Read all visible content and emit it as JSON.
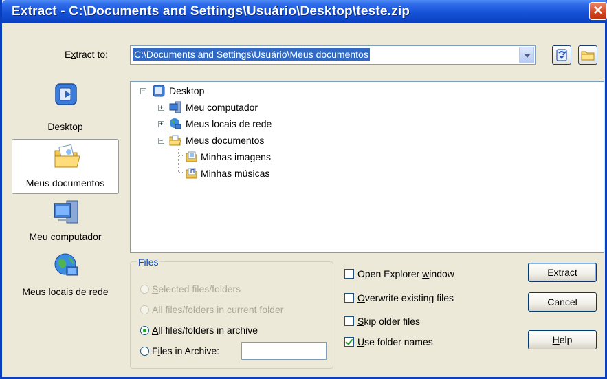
{
  "window": {
    "title": "Extract - C:\\Documents and Settings\\Usuário\\Desktop\\teste.zip",
    "close_glyph": "✕"
  },
  "extract_to": {
    "label_prefix": "E",
    "label_underlined": "x",
    "label_suffix": "tract to:",
    "path": "C:\\Documents and Settings\\Usuário\\Meus documentos"
  },
  "places": [
    {
      "label": "Desktop",
      "icon": "desktop-icon",
      "selected": false
    },
    {
      "label": "Meus documentos",
      "icon": "my-documents-icon",
      "selected": true
    },
    {
      "label": "Meu computador",
      "icon": "my-computer-icon",
      "selected": false
    },
    {
      "label": "Meus locais de rede",
      "icon": "network-places-icon",
      "selected": false
    }
  ],
  "tree": {
    "root": "Desktop",
    "items": [
      {
        "label": "Meu computador",
        "expander": "+"
      },
      {
        "label": "Meus locais de rede",
        "expander": "+"
      },
      {
        "label": "Meus documentos",
        "expander": "−"
      }
    ],
    "children": [
      {
        "label": "Minhas imagens"
      },
      {
        "label": "Minhas músicas"
      }
    ]
  },
  "files_group": {
    "title": "Files",
    "options": [
      {
        "pre": "",
        "u": "S",
        "post": "elected files/folders",
        "enabled": false,
        "checked": false
      },
      {
        "pre": "All files/folders in ",
        "u": "c",
        "post": "urrent folder",
        "enabled": false,
        "checked": false
      },
      {
        "pre": "",
        "u": "A",
        "post": "ll files/folders in archive",
        "enabled": true,
        "checked": true
      },
      {
        "pre": "F",
        "u": "i",
        "post": "les in Archive:",
        "enabled": true,
        "checked": false
      }
    ],
    "archive_input_value": ""
  },
  "options": [
    {
      "pre": "Open Explorer ",
      "u": "w",
      "post": "indow",
      "checked": false
    },
    {
      "pre": "",
      "u": "O",
      "post": "verwrite existing files",
      "checked": false
    },
    {
      "pre": "",
      "u": "S",
      "post": "kip older files",
      "checked": false
    },
    {
      "pre": "",
      "u": "U",
      "post": "se folder names",
      "checked": true
    }
  ],
  "buttons": {
    "extract": {
      "u": "E",
      "post": "xtract"
    },
    "cancel": {
      "label": "Cancel"
    },
    "help": {
      "u": "H",
      "post": "elp"
    }
  }
}
